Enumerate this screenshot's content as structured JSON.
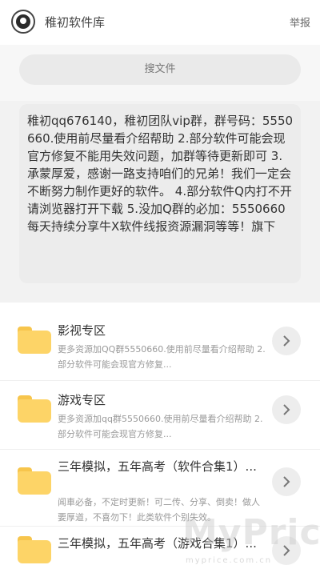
{
  "header": {
    "title": "稚初软件库",
    "report_label": "举报"
  },
  "search": {
    "placeholder": "搜文件"
  },
  "notice": {
    "text": "稚初qq676140，稚初团队vip群，群号码：5550660.使用前尽量看介绍帮助 2.部分软件可能会现官方修复不能用失效问题，加群等待更新即可 3.承蒙厚爱，感谢一路支持咱们的兄弟！我们一定会不断努力制作更好的软件。 4.部分软件Q内打不开请浏览器打开下载 5.没加Q群的必加：5550660每天持续分享牛X软件线报资源漏洞等等！旗下"
  },
  "items": [
    {
      "title": "影视专区",
      "desc": "更多资源加QQ群5550660.使用前尽量看介绍帮助 2.部分软件可能会现官方修复..."
    },
    {
      "title": "游戏专区",
      "desc": "更多资源加qq群5550660.使用前尽量看介绍帮助 2.部分软件可能会现官方修复..."
    },
    {
      "title": "三年模拟，五年高考（软件合集1）...",
      "desc": "闻車必备，不定时更新！可二传、分享、倒卖！做人要厚道，不喜勿下！此类软件个别失效。"
    },
    {
      "title": "三年模拟，五年高考（游戏合集1）...",
      "desc": ""
    }
  ],
  "watermark": {
    "brand": "MyPrice",
    "url": "myprice.com.cn"
  },
  "icons": {
    "logo": "logo-icon",
    "folder": "folder-icon",
    "chevron": "chevron-right-icon"
  },
  "colors": {
    "folder": "#fdd467",
    "background": "#f2f2f2"
  }
}
